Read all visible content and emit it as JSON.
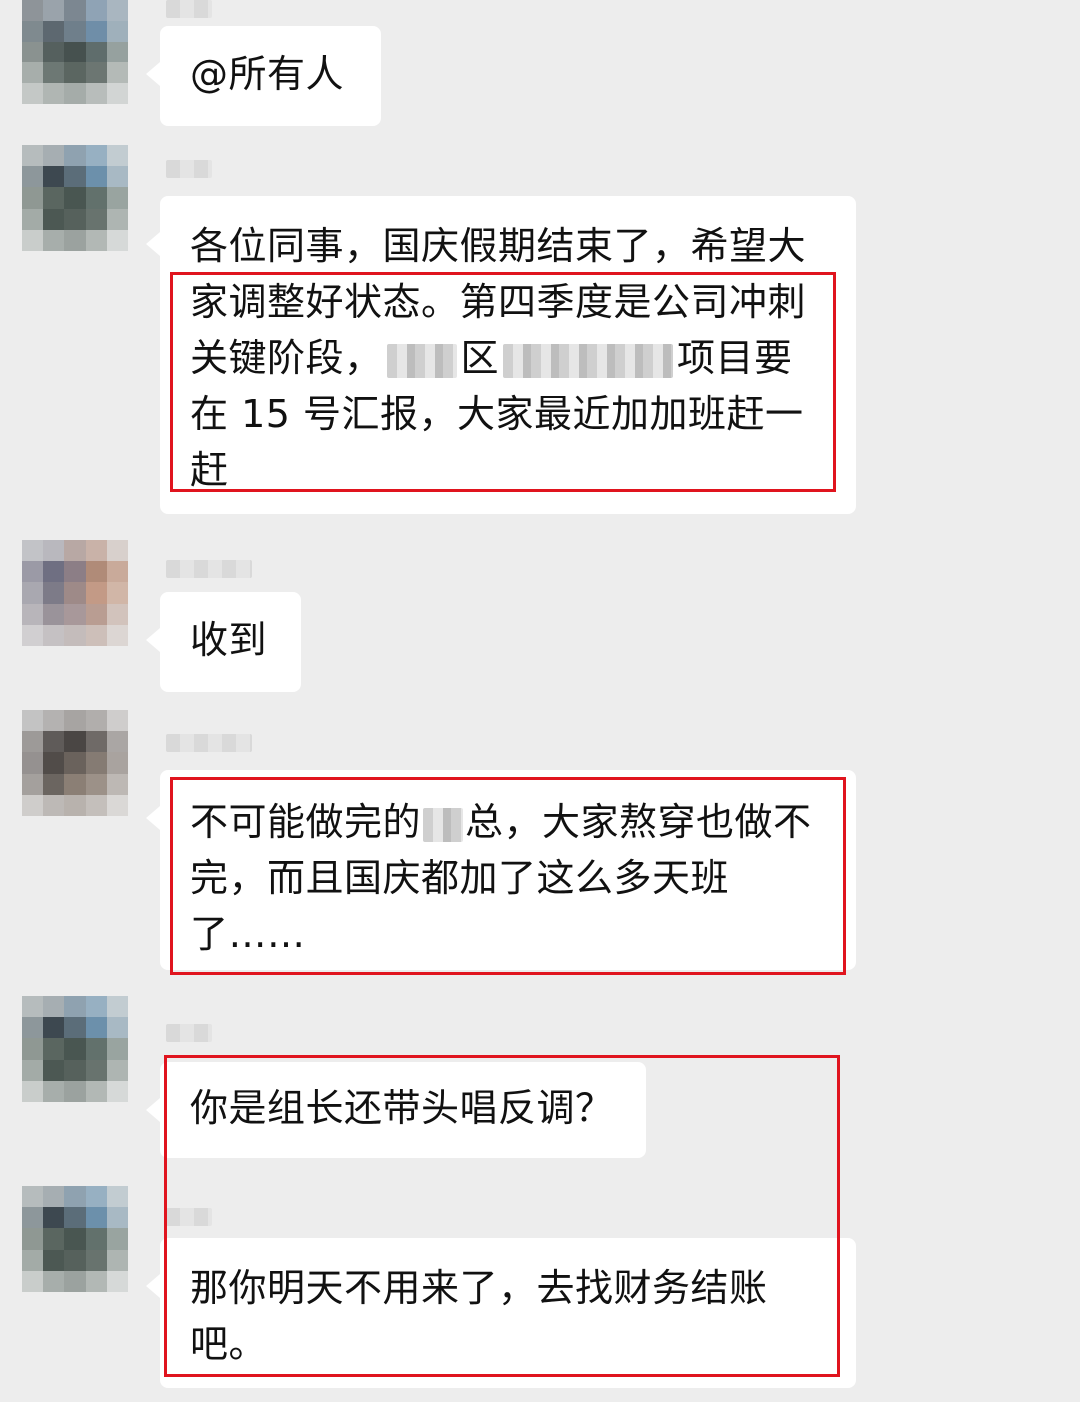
{
  "messages": [
    {
      "text": "@所有人"
    },
    {
      "line1": "各位同事，国庆假期结束了，希望大",
      "line2": "家调整好状态。第四季度是公司冲刺",
      "line3a": "关键阶段，",
      "line3b": "区",
      "line3c": "项目要",
      "line4": "在 15 号汇报，大家最近加加班赶一",
      "line5": "赶"
    },
    {
      "text": "收到"
    },
    {
      "line1a": "不可能做完的",
      "line1b": "总，大家熬穿也做不",
      "line2": "完，而且国庆都加了这么多天班",
      "line3": "了……"
    },
    {
      "text": "你是组长还带头唱反调？"
    },
    {
      "line1": "那你明天不用来了，去找财务结账",
      "line2": "吧。"
    }
  ],
  "colors": {
    "background": "#ededed",
    "bubble": "#ffffff",
    "highlight": "#e0141e"
  }
}
